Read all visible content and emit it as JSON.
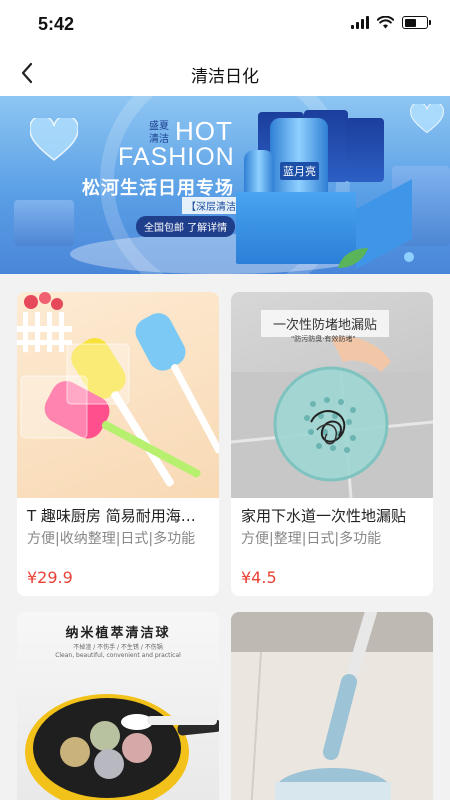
{
  "status": {
    "time": "5:42"
  },
  "nav": {
    "title": "清洁日化"
  },
  "banner": {
    "small_text": "盛夏清洁",
    "hot": "HOT",
    "fashion": "FASHION",
    "headline": "松河生活日用专场",
    "subtitle": "【深层清洁】",
    "cta": "全国包邮 了解详情",
    "brand": "蓝月亮"
  },
  "products": [
    {
      "title": "T 趣味厨房 简易耐用海绵刷",
      "tags": "方便|收纳整理|日式|多功能",
      "price": "¥29.9"
    },
    {
      "title": "家用下水道一次性地漏贴",
      "tags": "方便|整理|日式|多功能",
      "price": "¥4.5",
      "image_caption": "一次性防堵地漏贴",
      "image_subcaption": "\"防污防臭·有效防堵\""
    },
    {
      "image_caption": "纳米植萃清洁球",
      "image_subcaption_1": "不掉渣 / 不伤手 / 不生锈 / 不伤锅",
      "image_subcaption_2": "Clean, beautiful, convenient and practical"
    },
    {}
  ],
  "colors": {
    "price": "#e94337",
    "background": "#f2f2f2"
  }
}
